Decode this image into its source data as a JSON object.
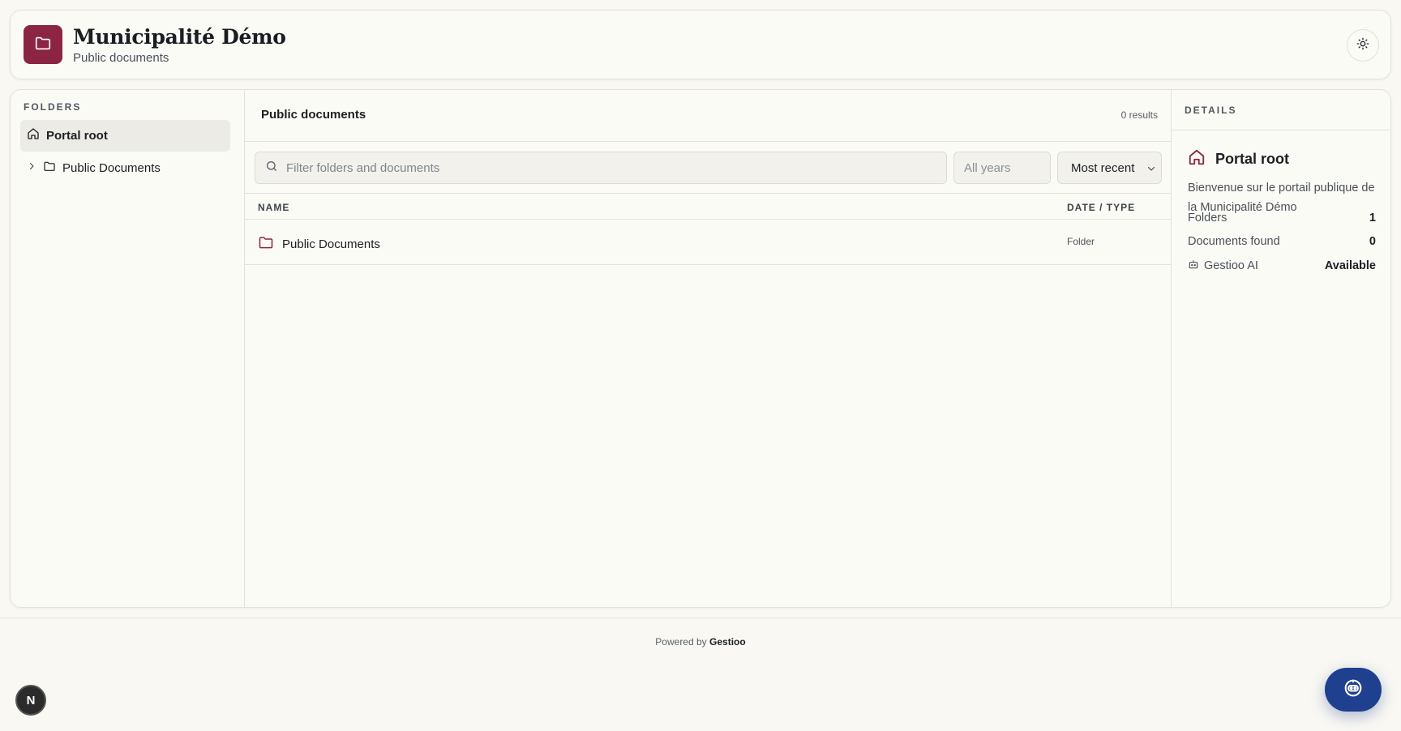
{
  "header": {
    "title": "Municipalité Démo",
    "subtitle": "Public documents",
    "brand_icon": "folder-icon",
    "theme_icon": "sun-icon",
    "brand_color": "#8c2443"
  },
  "sidebar": {
    "section_label": "FOLDERS",
    "root": {
      "label": "Portal root",
      "icon": "home-icon"
    },
    "items": [
      {
        "label": "Public Documents",
        "icon": "folder-icon",
        "expandable": true
      }
    ]
  },
  "main": {
    "title": "Public documents",
    "results": "0 results",
    "search": {
      "placeholder": "Filter folders and documents",
      "value": ""
    },
    "year_filter": {
      "placeholder": "All years"
    },
    "sort": {
      "selected": "Most recent"
    },
    "columns": {
      "name": "NAME",
      "date_type": "DATE / TYPE"
    },
    "rows": [
      {
        "name": "Public Documents",
        "type": "Folder",
        "icon": "folder-icon"
      }
    ]
  },
  "details": {
    "section_label": "DETAILS",
    "title": "Portal root",
    "description": "Bienvenue sur le portail publique de la Municipalité Démo",
    "stats": [
      {
        "label": "Folders",
        "value": "1"
      },
      {
        "label": "Documents found",
        "value": "0"
      },
      {
        "label": "Gestioo AI",
        "value": "Available",
        "icon": "robot-icon"
      }
    ]
  },
  "footer": {
    "prefix": "Powered by",
    "brand": "Gestioo"
  },
  "badge": {
    "label": "N"
  },
  "assistant_button": {
    "icon": "robot-icon",
    "color": "#1f3f8f"
  }
}
